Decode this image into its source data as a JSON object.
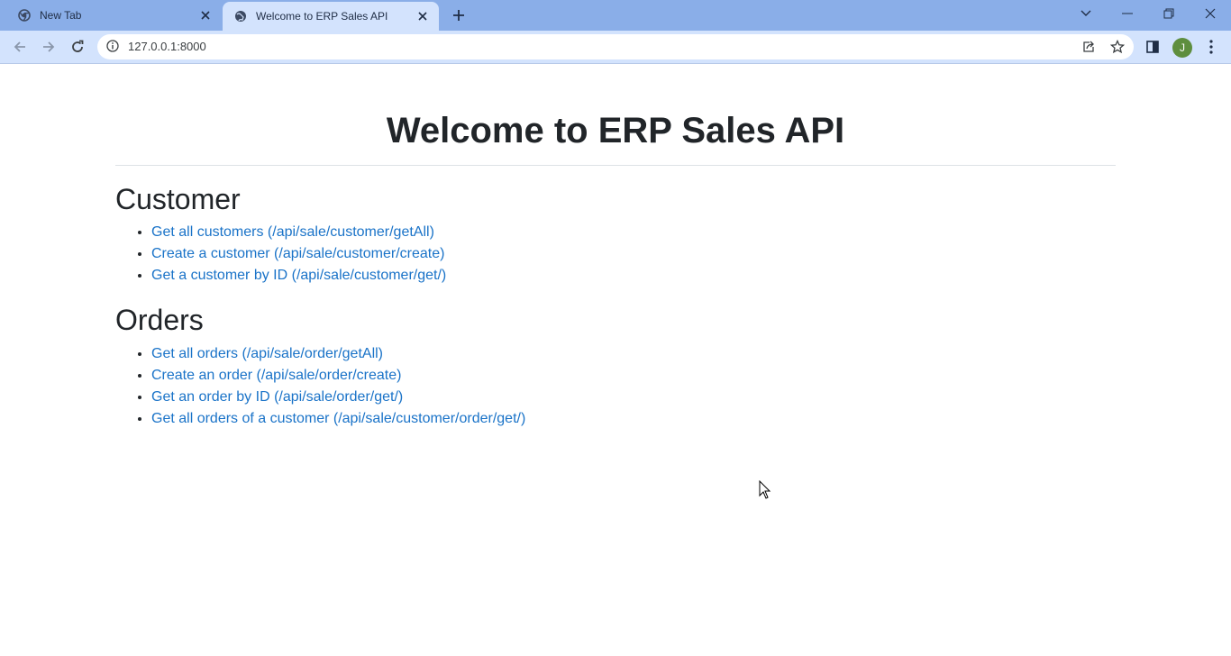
{
  "browser": {
    "tabs": [
      {
        "title": "New Tab",
        "active": false,
        "icon": "chrome-icon"
      },
      {
        "title": "Welcome to ERP Sales API",
        "active": true,
        "icon": "globe-icon"
      }
    ],
    "address": "127.0.0.1:8000",
    "profile_initial": "J"
  },
  "page": {
    "title": "Welcome to ERP Sales API",
    "sections": [
      {
        "heading": "Customer",
        "links": [
          "Get all customers (/api/sale/customer/getAll)",
          "Create a customer (/api/sale/customer/create)",
          "Get a customer by ID (/api/sale/customer/get/)"
        ]
      },
      {
        "heading": "Orders",
        "links": [
          "Get all orders (/api/sale/order/getAll)",
          "Create an order (/api/sale/order/create)",
          "Get an order by ID (/api/sale/order/get/)",
          "Get all orders of a customer (/api/sale/customer/order/get/)"
        ]
      }
    ]
  },
  "colors": {
    "tabstrip": "#8aaee8",
    "toolbar": "#d3e3fd",
    "link": "#1a73c8",
    "text": "#212529"
  }
}
